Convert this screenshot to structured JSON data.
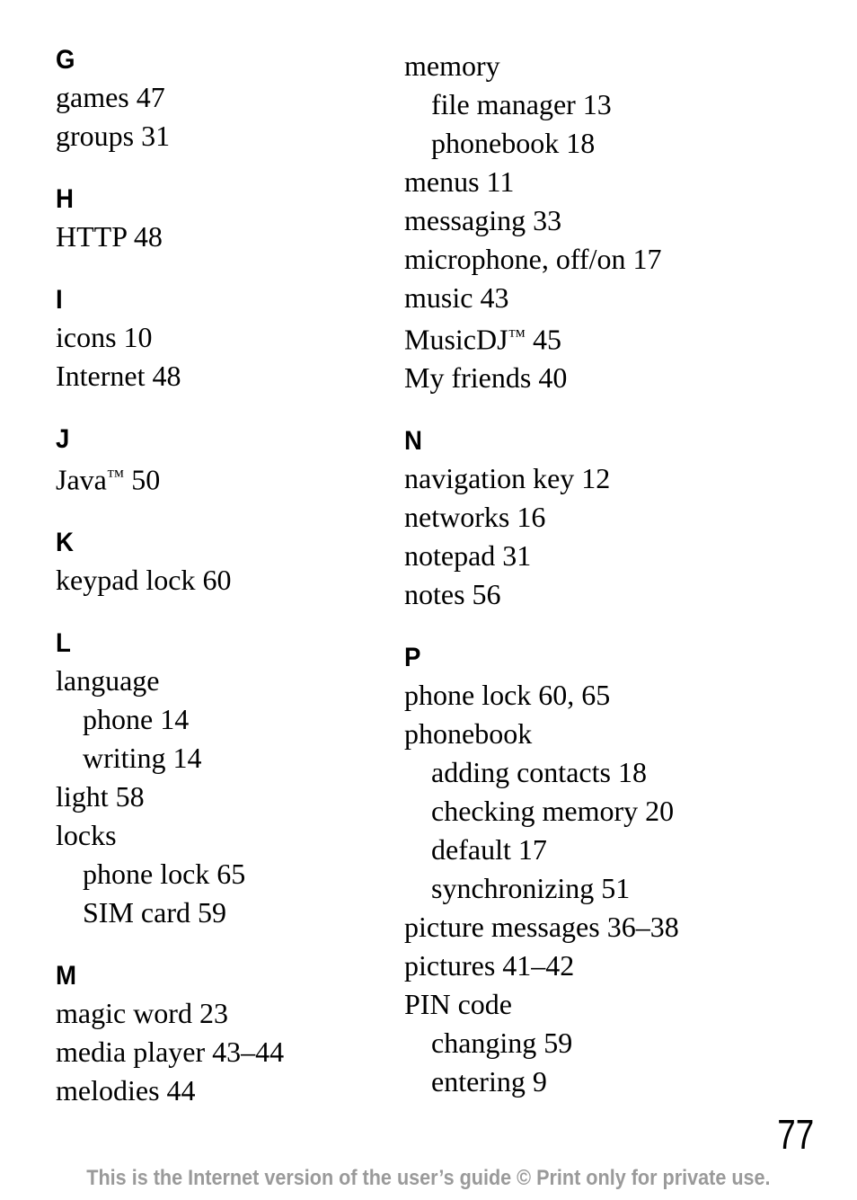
{
  "document": {
    "type": "index",
    "page_number": "77",
    "footer_text": "This is the Internet version of the user’s guide © Print only for private use.",
    "footer_color": "#9a9a9a",
    "text_color": "#000000",
    "background_color": "#ffffff"
  },
  "columns": [
    {
      "id": "left",
      "sections": [
        {
          "letter": "G",
          "entries": [
            {
              "text": "games 47",
              "level": 0
            },
            {
              "text": "groups 31",
              "level": 0
            }
          ]
        },
        {
          "letter": "H",
          "entries": [
            {
              "text": "HTTP 48",
              "level": 0
            }
          ]
        },
        {
          "letter": "I",
          "entries": [
            {
              "text": "icons 10",
              "level": 0
            },
            {
              "text": "Internet 48",
              "level": 0
            }
          ]
        },
        {
          "letter": "J",
          "entries": [
            {
              "text": "Java™ 50",
              "level": 0,
              "trademark": true,
              "base": "Java",
              "tail": " 50"
            }
          ]
        },
        {
          "letter": "K",
          "entries": [
            {
              "text": "keypad lock 60",
              "level": 0
            }
          ]
        },
        {
          "letter": "L",
          "entries": [
            {
              "text": "language",
              "level": 0
            },
            {
              "text": "phone 14",
              "level": 1
            },
            {
              "text": "writing 14",
              "level": 1
            },
            {
              "text": "light 58",
              "level": 0
            },
            {
              "text": "locks",
              "level": 0
            },
            {
              "text": "phone lock 65",
              "level": 1
            },
            {
              "text": "SIM card 59",
              "level": 1
            }
          ]
        },
        {
          "letter": "M",
          "entries": [
            {
              "text": "magic word 23",
              "level": 0
            },
            {
              "text": "media player 43–44",
              "level": 0
            },
            {
              "text": "melodies 44",
              "level": 0
            }
          ]
        }
      ]
    },
    {
      "id": "right",
      "sections": [
        {
          "letter": "",
          "entries": [
            {
              "text": "memory",
              "level": 0
            },
            {
              "text": "file manager 13",
              "level": 1
            },
            {
              "text": "phonebook 18",
              "level": 1
            },
            {
              "text": "menus 11",
              "level": 0
            },
            {
              "text": "messaging 33",
              "level": 0
            },
            {
              "text": "microphone, off/on 17",
              "level": 0
            },
            {
              "text": "music 43",
              "level": 0
            },
            {
              "text": "MusicDJ™ 45",
              "level": 0,
              "trademark": true,
              "base": "MusicDJ",
              "tail": " 45"
            },
            {
              "text": "My friends 40",
              "level": 0
            }
          ]
        },
        {
          "letter": "N",
          "entries": [
            {
              "text": "navigation key 12",
              "level": 0
            },
            {
              "text": "networks 16",
              "level": 0
            },
            {
              "text": "notepad 31",
              "level": 0
            },
            {
              "text": "notes 56",
              "level": 0
            }
          ]
        },
        {
          "letter": "P",
          "entries": [
            {
              "text": "phone lock 60, 65",
              "level": 0
            },
            {
              "text": "phonebook",
              "level": 0
            },
            {
              "text": "adding contacts 18",
              "level": 1
            },
            {
              "text": "checking memory 20",
              "level": 1
            },
            {
              "text": "default 17",
              "level": 1
            },
            {
              "text": "synchronizing 51",
              "level": 1
            },
            {
              "text": "picture messages 36–38",
              "level": 0
            },
            {
              "text": "pictures 41–42",
              "level": 0
            },
            {
              "text": "PIN code",
              "level": 0
            },
            {
              "text": "changing 59",
              "level": 1
            },
            {
              "text": "entering 9",
              "level": 1
            }
          ]
        }
      ]
    }
  ]
}
